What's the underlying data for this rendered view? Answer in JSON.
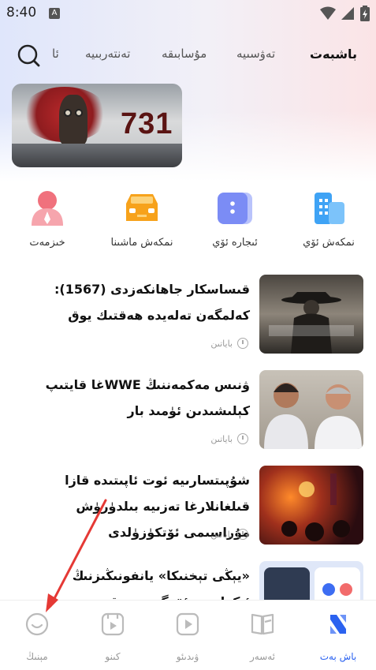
{
  "status": {
    "time": "8:40",
    "notif_letter": "A"
  },
  "tabs": [
    {
      "label": "باشبەت",
      "active": true
    },
    {
      "label": "تەۋسىيە",
      "active": false
    },
    {
      "label": "مۇسابىقە",
      "active": false
    },
    {
      "label": "تەنتەربىيە",
      "active": false
    },
    {
      "label": "ئا",
      "active": false
    }
  ],
  "banner": {
    "text": "731"
  },
  "quick": [
    {
      "label": "نمكەش ئۆي",
      "icon": "building-icon",
      "color": "#3fa3f5"
    },
    {
      "label": "ئىجارە ئۆي",
      "icon": "house-icon",
      "color": "#7b8cf5"
    },
    {
      "label": "نمكەش ماشىنا",
      "icon": "car-icon",
      "color": "#f7a21b"
    },
    {
      "label": "خىزمەت",
      "icon": "person-icon",
      "color": "#f0717d"
    }
  ],
  "news": [
    {
      "title": "قىساسكار جاھانكەزدى (1567): كەلمگەن تەلەيدە ھەقتىك يوق",
      "meta": "باياتىن"
    },
    {
      "title": "ۋنىس مەكمەننىڭ WWEغا قايتىپ كېلىشىدىن ئۈمىد بار",
      "meta": "باياتىن"
    },
    {
      "title": "شۇپىتسارىيە ئوت ئاپىتىدە قازا قىلغانلارغا تەزىيە بىلدۈرۈش مۇراسىمى ئۆتكۈزۈلدى",
      "meta": "باياتىن"
    },
    {
      "title": "«يېڭى تېخنىكا» يانفونىڭىزنىڭ ئېكرانىنى ئۆزگەرتىپ قويدى",
      "meta": ""
    }
  ],
  "nav": [
    {
      "label": "باش بەت",
      "icon": "home-icon",
      "active": true
    },
    {
      "label": "ئەسەر",
      "icon": "book-icon",
      "active": false
    },
    {
      "label": "ۋىدىئو",
      "icon": "video-icon",
      "active": false
    },
    {
      "label": "كىنو",
      "icon": "movie-icon",
      "active": false
    },
    {
      "label": "مېنىڭ",
      "icon": "profile-icon",
      "active": false
    }
  ],
  "colors": {
    "accent": "#2b62f0",
    "arrow": "#e53935"
  }
}
